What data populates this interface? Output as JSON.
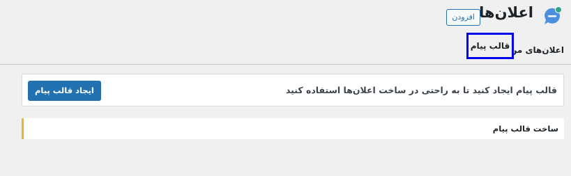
{
  "header": {
    "title": "اعلان‌ها",
    "add_button": "افزودن",
    "icon": "chat-bubble-icon",
    "icon_color": "#4a8fe0",
    "icon_dot_color": "#2fa58b"
  },
  "tabs": [
    {
      "label": "اعلان‌های من",
      "active": false
    },
    {
      "label": "قالب پیام",
      "active": true
    }
  ],
  "notice": {
    "text": "قالب پیام ایجاد کنید تا به راحتی در ساخت اعلان‌ها استفاده کنید",
    "button": "ایجاد قالب پیام"
  },
  "section": {
    "title": "ساخت قالب پیام",
    "accent_color": "#f0b429"
  }
}
